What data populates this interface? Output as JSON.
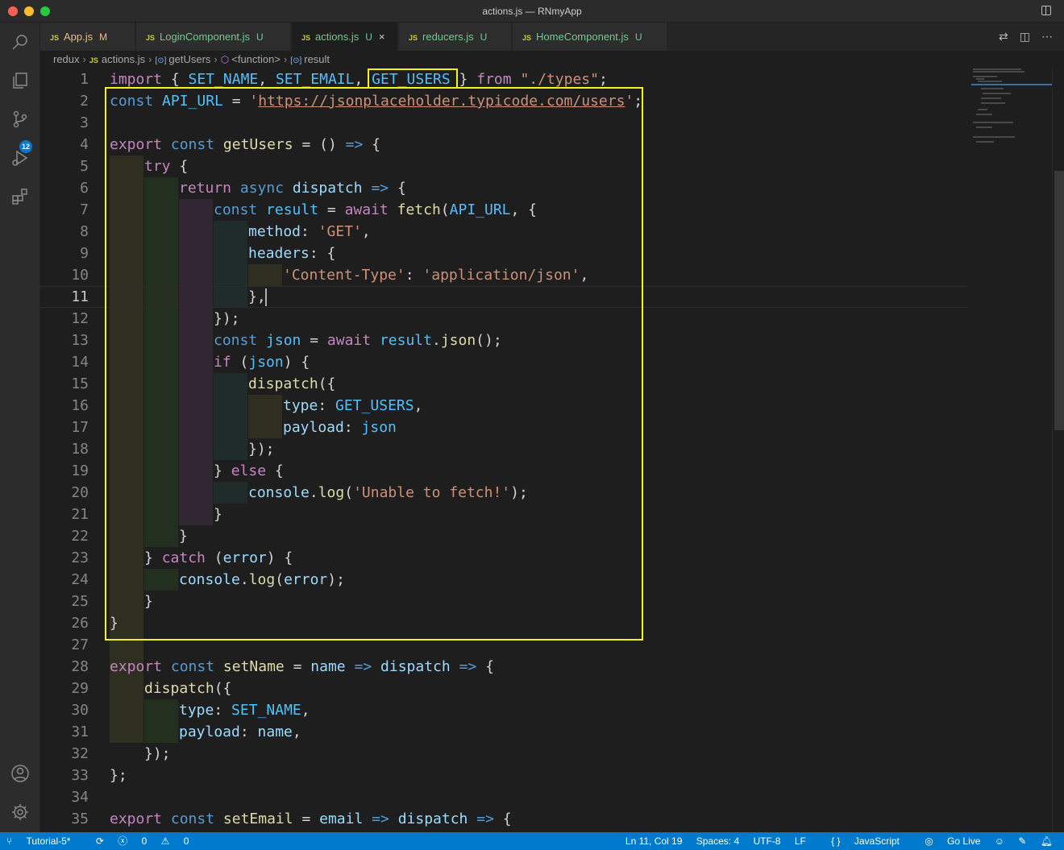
{
  "window": {
    "title": "actions.js — RNmyApp"
  },
  "activity_bar": {
    "scm_badge": "12"
  },
  "tabs": [
    {
      "label": "App.js",
      "status": "M",
      "active": false
    },
    {
      "label": "LoginComponent.js",
      "status": "U",
      "active": false
    },
    {
      "label": "actions.js",
      "status": "U",
      "active": true
    },
    {
      "label": "reducers.js",
      "status": "U",
      "active": false
    },
    {
      "label": "HomeComponent.js",
      "status": "U",
      "active": false
    }
  ],
  "tab_file_icon": "JS",
  "close_glyph": "×",
  "breadcrumb": {
    "folder": "redux",
    "file": "actions.js",
    "symbol1": "getUsers",
    "symbol2": "<function>",
    "symbol3": "result"
  },
  "editor": {
    "current_line": 11,
    "line_numbers": [
      "1",
      "2",
      "3",
      "4",
      "5",
      "6",
      "7",
      "8",
      "9",
      "10",
      "11",
      "12",
      "13",
      "14",
      "15",
      "16",
      "17",
      "18",
      "19",
      "20",
      "21",
      "22",
      "23",
      "24",
      "25",
      "26",
      "27",
      "28",
      "29",
      "30",
      "31",
      "32",
      "33",
      "34",
      "35"
    ],
    "code": {
      "l1": {
        "a": "import",
        "b": " { ",
        "c": "SET_NAME",
        "d": ", ",
        "e": "SET_EMAIL",
        "f": ", ",
        "g": "GET_USERS",
        "h": " } ",
        "i": "from",
        "j": " ",
        "k": "\"./types\"",
        "l": ";"
      },
      "l2": {
        "a": "const",
        "b": " ",
        "c": "API_URL",
        "d": " = ",
        "e": "'",
        "f": "https://jsonplaceholder.typicode.com/users",
        "g": "'",
        "h": ";"
      },
      "l4": {
        "a": "export",
        "b": " ",
        "c": "const",
        "d": " ",
        "e": "getUsers",
        "f": " = () ",
        "g": "=>",
        "h": " {"
      },
      "l5": {
        "a": "try",
        "b": " {"
      },
      "l6": {
        "a": "return",
        "b": " ",
        "c": "async",
        "d": " ",
        "e": "dispatch",
        "f": " ",
        "g": "=>",
        "h": " {"
      },
      "l7": {
        "a": "const",
        "b": " ",
        "c": "result",
        "d": " = ",
        "e": "await",
        "f": " ",
        "g": "fetch",
        "h": "(",
        "i": "API_URL",
        "j": ", {"
      },
      "l8": {
        "a": "method",
        "b": ": ",
        "c": "'GET'",
        "d": ","
      },
      "l9": {
        "a": "headers",
        "b": ": {"
      },
      "l10": {
        "a": "'Content-Type'",
        "b": ": ",
        "c": "'application/json'",
        "d": ","
      },
      "l11": {
        "a": "},"
      },
      "l12": {
        "a": "});"
      },
      "l13": {
        "a": "const",
        "b": " ",
        "c": "json",
        "d": " = ",
        "e": "await",
        "f": " ",
        "g": "result",
        "h": ".",
        "i": "json",
        "j": "();"
      },
      "l14": {
        "a": "if",
        "b": " (",
        "c": "json",
        "d": ") {"
      },
      "l15": {
        "a": "dispatch",
        "b": "({"
      },
      "l16": {
        "a": "type",
        "b": ": ",
        "c": "GET_USERS",
        "d": ","
      },
      "l17": {
        "a": "payload",
        "b": ": ",
        "c": "json"
      },
      "l18": {
        "a": "});"
      },
      "l19": {
        "a": "} ",
        "b": "else",
        "c": " {"
      },
      "l20": {
        "a": "console",
        "b": ".",
        "c": "log",
        "d": "(",
        "e": "'Unable to fetch!'",
        "f": ");"
      },
      "l21": {
        "a": "}"
      },
      "l22": {
        "a": "}"
      },
      "l23": {
        "a": "} ",
        "b": "catch",
        "c": " (",
        "d": "error",
        "e": ") {"
      },
      "l24": {
        "a": "console",
        "b": ".",
        "c": "log",
        "d": "(",
        "e": "error",
        "f": ");"
      },
      "l25": {
        "a": "}"
      },
      "l26": {
        "a": "}"
      },
      "l28": {
        "a": "export",
        "b": " ",
        "c": "const",
        "d": " ",
        "e": "setName",
        "f": " = ",
        "g": "name",
        "h": " ",
        "i": "=>",
        "j": " ",
        "k": "dispatch",
        "l": " ",
        "m": "=>",
        "n": " {"
      },
      "l29": {
        "a": "dispatch",
        "b": "({"
      },
      "l30": {
        "a": "type",
        "b": ": ",
        "c": "SET_NAME",
        "d": ","
      },
      "l31": {
        "a": "payload",
        "b": ": ",
        "c": "name",
        "d": ","
      },
      "l32": {
        "a": "});"
      },
      "l33": {
        "a": "};"
      },
      "l35": {
        "a": "export",
        "b": " ",
        "c": "const",
        "d": " ",
        "e": "setEmail",
        "f": " = ",
        "g": "email",
        "h": " ",
        "i": "=>",
        "j": " ",
        "k": "dispatch",
        "l": " ",
        "m": "=>",
        "n": " {"
      }
    }
  },
  "status_bar": {
    "branch": "Tutorial-5*",
    "errors": "0",
    "warnings": "0",
    "position": "Ln 11, Col 19",
    "spaces": "Spaces: 4",
    "encoding": "UTF-8",
    "eol": "LF",
    "language": "JavaScript",
    "go_live": "Go Live"
  },
  "colors": {
    "status_bar_bg": "#007acc",
    "highlight_box": "#f4f41a",
    "keyword": "#569cd6",
    "control": "#c586c0",
    "string": "#ce9178",
    "function": "#dcdcaa",
    "variable": "#9cdcfe",
    "constant": "#4fc1ff"
  },
  "icons": {
    "activity": [
      "search-icon",
      "explorer-icon",
      "source-control-icon",
      "run-debug-icon",
      "extensions-icon",
      "account-icon",
      "settings-gear-icon"
    ],
    "tab_actions": [
      "compare-changes-icon",
      "split-editor-icon",
      "more-actions-icon"
    ]
  }
}
